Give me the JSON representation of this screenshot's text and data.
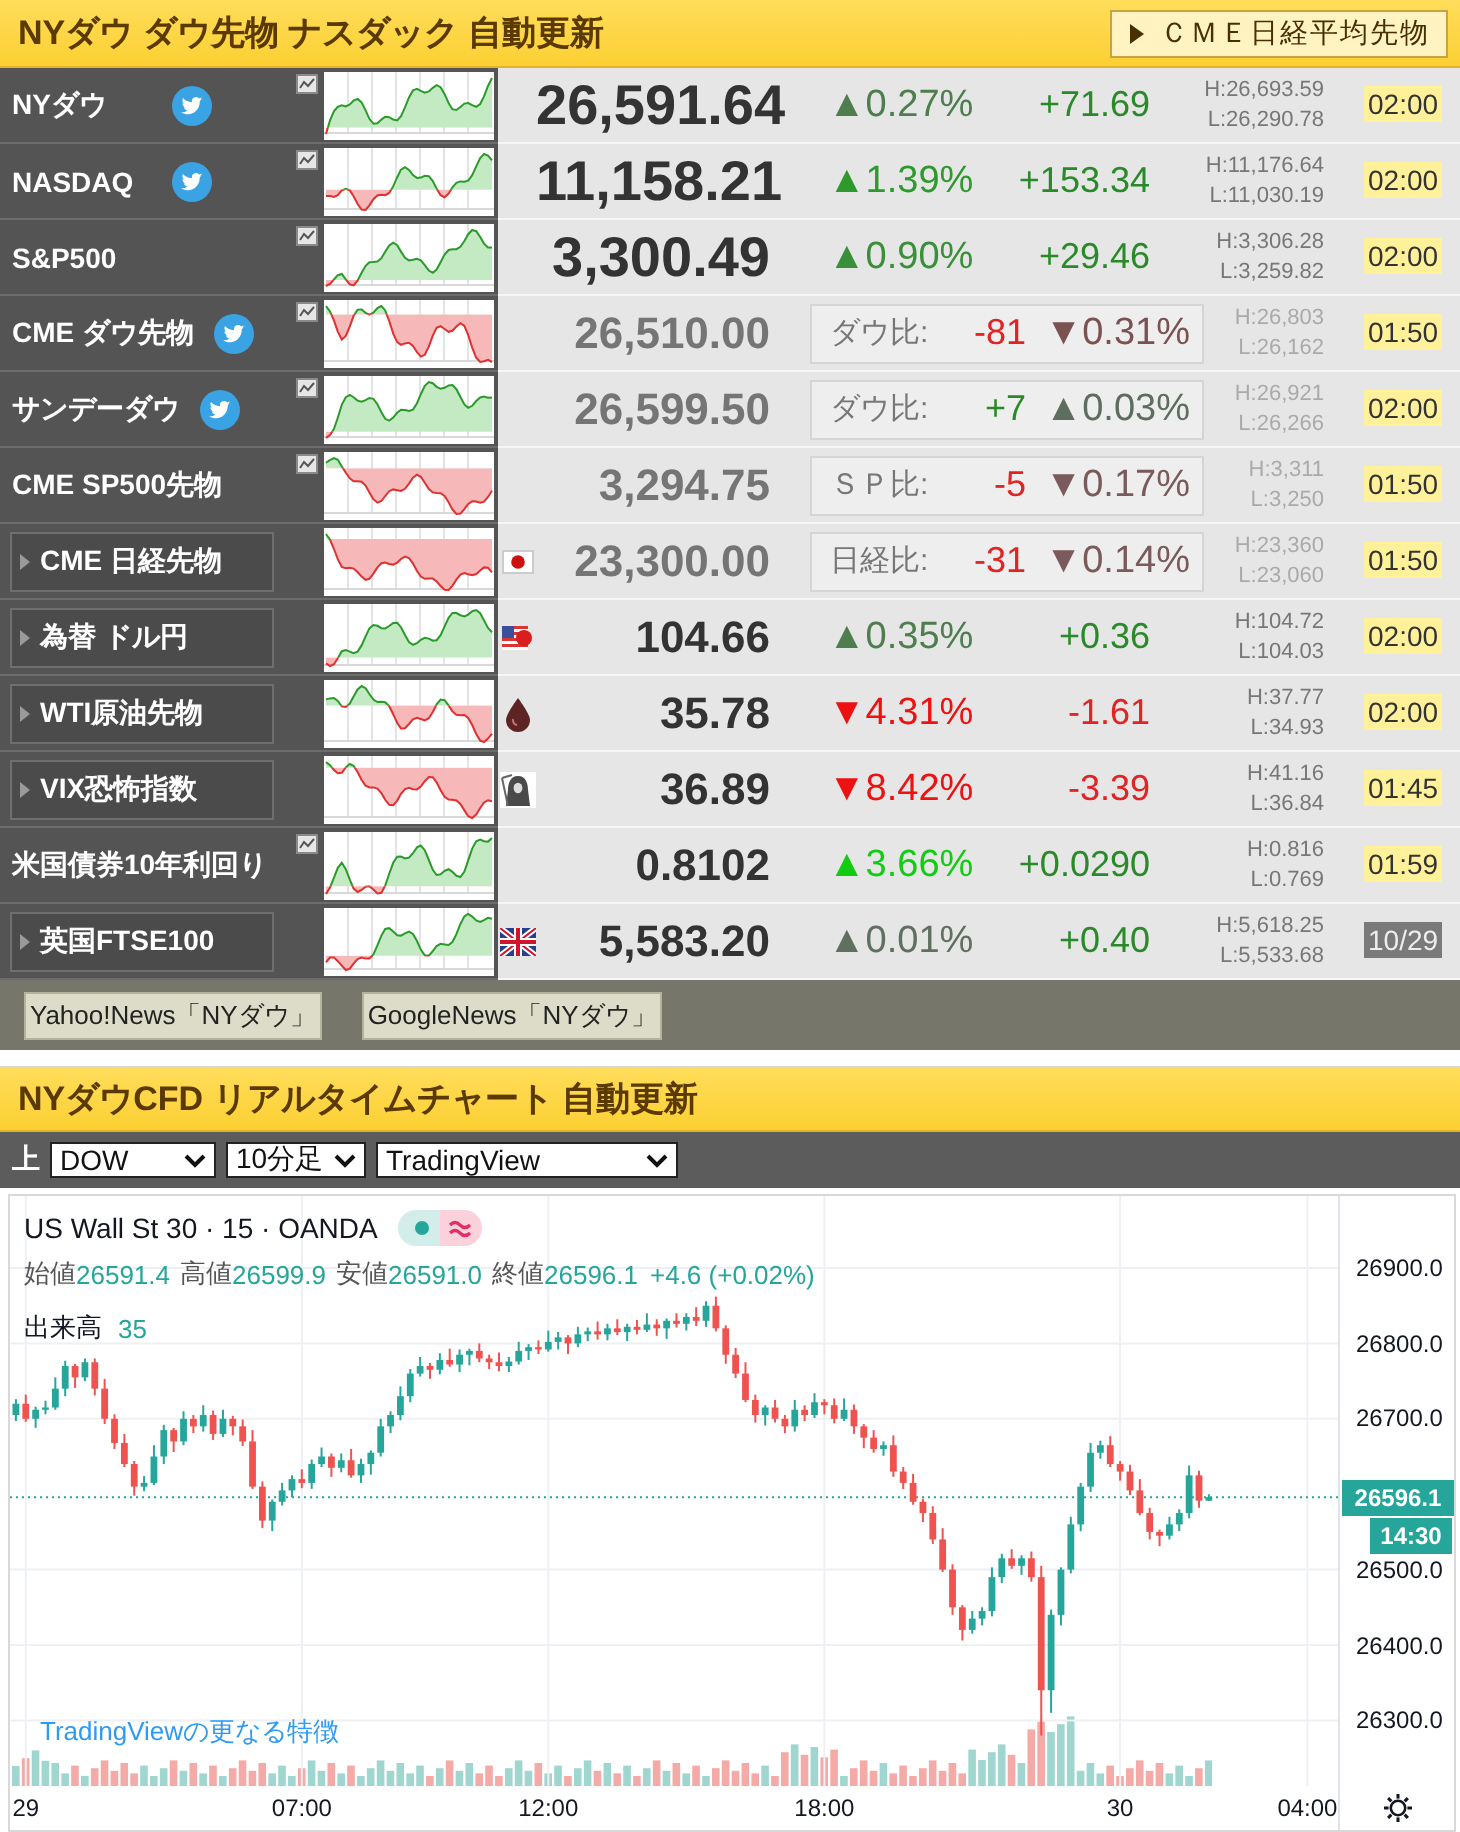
{
  "header": {
    "title": "NYダウ ダウ先物 ナスダック 自動更新",
    "link": "ＣＭＥ日経平均先物"
  },
  "quotes": [
    {
      "kind": "major",
      "name": "NYダウ",
      "twitter": true,
      "chart_button": true,
      "expandable": false,
      "rising": true,
      "price": "26,591.64",
      "percent": {
        "text": "▲0.27%",
        "color": "#4e7d4e"
      },
      "change": "+71.69",
      "high": "H:26,693.59",
      "low": "L:26,290.78",
      "time": "02:00",
      "closed": false
    },
    {
      "kind": "major",
      "name": "NASDAQ",
      "twitter": true,
      "chart_button": true,
      "expandable": false,
      "rising": true,
      "price": "11,158.21",
      "percent": {
        "text": "▲1.39%",
        "color": "#2e9a2e"
      },
      "change": "+153.34",
      "high": "H:11,176.64",
      "low": "L:11,030.19",
      "time": "02:00",
      "closed": false
    },
    {
      "kind": "major",
      "name": "S&P500",
      "twitter": false,
      "chart_button": true,
      "expandable": false,
      "rising": true,
      "price": "3,300.49",
      "percent": {
        "text": "▲0.90%",
        "color": "#3a8f3a"
      },
      "change": "+29.46",
      "high": "H:3,306.28",
      "low": "L:3,259.82",
      "time": "02:00",
      "closed": false
    },
    {
      "kind": "future",
      "name": "CME ダウ先物",
      "twitter": true,
      "chart_button": true,
      "expandable": false,
      "rising": false,
      "price": "26,510.00",
      "compare": {
        "label": "ダウ比:",
        "diff": "-81",
        "percent": "▼0.31%",
        "color": "#7a5252"
      },
      "high": "H:26,803",
      "low": "L:26,162",
      "time": "01:50",
      "closed": false
    },
    {
      "kind": "future",
      "name": "サンデーダウ",
      "twitter": true,
      "chart_button": true,
      "expandable": false,
      "rising": true,
      "price": "26,599.50",
      "compare": {
        "label": "ダウ比:",
        "diff": "+7",
        "percent": "▲0.03%",
        "color": "#5e6e5e"
      },
      "high": "H:26,921",
      "low": "L:26,266",
      "time": "02:00",
      "closed": false
    },
    {
      "kind": "future",
      "name": "CME SP500先物",
      "twitter": false,
      "chart_button": true,
      "expandable": false,
      "rising": false,
      "price": "3,294.75",
      "compare": {
        "label": "ＳＰ比:",
        "diff": "-5",
        "percent": "▼0.17%",
        "color": "#7a5a5a"
      },
      "high": "H:3,311",
      "low": "L:3,250",
      "time": "01:50",
      "closed": false
    },
    {
      "kind": "future",
      "name": "CME 日経先物",
      "twitter": false,
      "chart_button": false,
      "expandable": true,
      "rising": false,
      "price": "23,300.00",
      "compare": {
        "label": "日経比:",
        "diff": "-31",
        "percent": "▼0.14%",
        "color": "#7a5a5a"
      },
      "high": "H:23,360",
      "low": "L:23,060",
      "time": "01:50",
      "closed": false
    },
    {
      "kind": "other",
      "name": "為替 ドル円",
      "twitter": false,
      "chart_button": false,
      "expandable": true,
      "rising": true,
      "price": "104.66",
      "percent": {
        "text": "▲0.35%",
        "color": "#4e7d4e"
      },
      "change": "+0.36",
      "high": "H:104.72",
      "low": "L:104.03",
      "time": "02:00",
      "closed": false
    },
    {
      "kind": "other",
      "name": "WTI原油先物",
      "twitter": false,
      "chart_button": false,
      "expandable": true,
      "rising": false,
      "price": "35.78",
      "percent": {
        "text": "▼4.31%",
        "color": "#ee1111"
      },
      "change": "-1.61",
      "high": "H:37.77",
      "low": "L:34.93",
      "time": "02:00",
      "closed": false
    },
    {
      "kind": "other",
      "name": "VIX恐怖指数",
      "twitter": false,
      "chart_button": false,
      "expandable": true,
      "rising": false,
      "price": "36.89",
      "percent": {
        "text": "▼8.42%",
        "color": "#ee1111"
      },
      "change": "-3.39",
      "high": "H:41.16",
      "low": "L:36.84",
      "time": "01:45",
      "closed": false
    },
    {
      "kind": "other",
      "name": "米国債券10年利回り",
      "twitter": false,
      "chart_button": true,
      "expandable": false,
      "rising": true,
      "price": "0.8102",
      "percent": {
        "text": "▲3.66%",
        "color": "#11cc11"
      },
      "change": "+0.0290",
      "high": "H:0.816",
      "low": "L:0.769",
      "time": "01:59",
      "closed": false
    },
    {
      "kind": "other",
      "name": "英国FTSE100",
      "twitter": false,
      "chart_button": false,
      "expandable": true,
      "rising": true,
      "price": "5,583.20",
      "percent": {
        "text": "▲0.01%",
        "color": "#607060"
      },
      "change": "+0.40",
      "high": "H:5,618.25",
      "low": "L:5,533.68",
      "time": "10/29",
      "closed": true
    }
  ],
  "news_links": [
    "Yahoo!News「NYダウ」",
    "GoogleNews「NYダウ」"
  ],
  "chart_section": {
    "title": "NYダウCFD リアルタイムチャート 自動更新",
    "toolbar": {
      "label": "上",
      "selects": [
        "DOW",
        "10分足",
        "TradingView"
      ]
    },
    "chart": {
      "symbol": "US Wall St 30 · 15 · OANDA",
      "ohlc": [
        {
          "label": "始値",
          "value": "26591.4"
        },
        {
          "label": "高値",
          "value": "26599.9"
        },
        {
          "label": "安値",
          "value": "26591.0"
        },
        {
          "label": "終値",
          "value": "26596.1"
        }
      ],
      "change": "+4.6 (+0.02%)",
      "volume_label": "出来高",
      "volume": "35",
      "last_price": "26596.1",
      "countdown": "14:30",
      "promo_link": "TradingViewの更なる特徴",
      "chart_data": {
        "type": "candlestick",
        "categories": [
          null,
          "29",
          null,
          null,
          null,
          null,
          null,
          null,
          null,
          null,
          null,
          null,
          null,
          null,
          null,
          null,
          null,
          null,
          null,
          null,
          null,
          null,
          null,
          null,
          null,
          null,
          null,
          null,
          null,
          "07:00",
          null,
          null,
          null,
          null,
          null,
          null,
          null,
          null,
          null,
          null,
          null,
          null,
          null,
          null,
          null,
          null,
          null,
          null,
          null,
          null,
          null,
          null,
          null,
          null,
          "12:00",
          null,
          null,
          null,
          null,
          null,
          null,
          null,
          null,
          null,
          null,
          null,
          null,
          null,
          null,
          null,
          null,
          null,
          null,
          null,
          null,
          null,
          null,
          null,
          null,
          null,
          null,
          null,
          "18:00",
          null,
          null,
          null,
          null,
          null,
          null,
          null,
          null,
          null,
          null,
          null,
          null,
          null,
          null,
          null,
          null,
          null,
          null,
          null,
          null,
          null,
          null,
          null,
          null,
          null,
          null,
          null,
          null,
          null,
          "30",
          null,
          null,
          null,
          null,
          null,
          null,
          null,
          null,
          null,
          null,
          null,
          null,
          null,
          null,
          null,
          null,
          null,
          null,
          "04:00"
        ],
        "ohlc": [
          [
            26705,
            26726,
            26697,
            26720
          ],
          [
            26720,
            26732,
            26696,
            26700
          ],
          [
            26700,
            26716,
            26688,
            26712
          ],
          [
            26712,
            26724,
            26706,
            26715
          ],
          [
            26715,
            26755,
            26712,
            26740
          ],
          [
            26740,
            26777,
            26730,
            26770
          ],
          [
            26770,
            26773,
            26741,
            26755
          ],
          [
            26755,
            26780,
            26750,
            26775
          ],
          [
            26775,
            26780,
            26731,
            26740
          ],
          [
            26740,
            26753,
            26693,
            26700
          ],
          [
            26700,
            26706,
            26660,
            26668
          ],
          [
            26668,
            26680,
            26636,
            26640
          ],
          [
            26640,
            26644,
            26598,
            26610
          ],
          [
            26610,
            26624,
            26604,
            26615
          ],
          [
            26615,
            26665,
            26612,
            26650
          ],
          [
            26650,
            26692,
            26640,
            26685
          ],
          [
            26685,
            26688,
            26656,
            26670
          ],
          [
            26670,
            26710,
            26665,
            26700
          ],
          [
            26700,
            26705,
            26681,
            26690
          ],
          [
            26690,
            26718,
            26683,
            26705
          ],
          [
            26705,
            26711,
            26672,
            26680
          ],
          [
            26680,
            26712,
            26676,
            26700
          ],
          [
            26700,
            26704,
            26678,
            26690
          ],
          [
            26690,
            26699,
            26664,
            26670
          ],
          [
            26670,
            26685,
            26607,
            26610
          ],
          [
            26610,
            26617,
            26555,
            26565
          ],
          [
            26565,
            26593,
            26551,
            26590
          ],
          [
            26590,
            26615,
            26585,
            26605
          ],
          [
            26605,
            26625,
            26596,
            26620
          ],
          [
            26620,
            26633,
            26608,
            26615
          ],
          [
            26615,
            26646,
            26607,
            26640
          ],
          [
            26640,
            26662,
            26636,
            26650
          ],
          [
            26650,
            26654,
            26623,
            26635
          ],
          [
            26635,
            26654,
            26629,
            26645
          ],
          [
            26645,
            26660,
            26622,
            26625
          ],
          [
            26625,
            26647,
            26615,
            26640
          ],
          [
            26640,
            26658,
            26626,
            26655
          ],
          [
            26655,
            26700,
            26650,
            26690
          ],
          [
            26690,
            26710,
            26681,
            26705
          ],
          [
            26705,
            26743,
            26698,
            26730
          ],
          [
            26730,
            26766,
            26722,
            26760
          ],
          [
            26760,
            26782,
            26756,
            26770
          ],
          [
            26770,
            26774,
            26753,
            26765
          ],
          [
            26765,
            26787,
            26759,
            26778
          ],
          [
            26778,
            26793,
            26769,
            26772
          ],
          [
            26772,
            26792,
            26762,
            26785
          ],
          [
            26785,
            26793,
            26771,
            26790
          ],
          [
            26790,
            26800,
            26775,
            26780
          ],
          [
            26780,
            26785,
            26766,
            26775
          ],
          [
            26775,
            26788,
            26763,
            26770
          ],
          [
            26770,
            26782,
            26762,
            26776
          ],
          [
            26776,
            26802,
            26772,
            26790
          ],
          [
            26790,
            26799,
            26778,
            26795
          ],
          [
            26795,
            26804,
            26786,
            26792
          ],
          [
            26792,
            26817,
            26789,
            26802
          ],
          [
            26802,
            26815,
            26792,
            26808
          ],
          [
            26808,
            26811,
            26786,
            26800
          ],
          [
            26800,
            26822,
            26795,
            26812
          ],
          [
            26812,
            26821,
            26803,
            26816
          ],
          [
            26816,
            26829,
            26805,
            26812
          ],
          [
            26812,
            26826,
            26804,
            26820
          ],
          [
            26820,
            26832,
            26811,
            26815
          ],
          [
            26815,
            26826,
            26803,
            26822
          ],
          [
            26822,
            26831,
            26812,
            26818
          ],
          [
            26818,
            26840,
            26815,
            26825
          ],
          [
            26825,
            26832,
            26810,
            26820
          ],
          [
            26820,
            26833,
            26806,
            26830
          ],
          [
            26830,
            26840,
            26821,
            26826
          ],
          [
            26826,
            26840,
            26817,
            26835
          ],
          [
            26835,
            26848,
            26823,
            26830
          ],
          [
            26830,
            26856,
            26822,
            26850
          ],
          [
            26850,
            26862,
            26816,
            26820
          ],
          [
            26820,
            26824,
            26773,
            26785
          ],
          [
            26785,
            26794,
            26754,
            26760
          ],
          [
            26760,
            26775,
            26722,
            26725
          ],
          [
            26725,
            26732,
            26695,
            26705
          ],
          [
            26705,
            26718,
            26691,
            26715
          ],
          [
            26715,
            26725,
            26695,
            26700
          ],
          [
            26700,
            26705,
            26681,
            26690
          ],
          [
            26690,
            26725,
            26683,
            26712
          ],
          [
            26712,
            26718,
            26697,
            26705
          ],
          [
            26705,
            26734,
            26701,
            26722
          ],
          [
            26722,
            26726,
            26706,
            26718
          ],
          [
            26718,
            26727,
            26694,
            26700
          ],
          [
            26700,
            26727,
            26697,
            26712
          ],
          [
            26712,
            26719,
            26680,
            26690
          ],
          [
            26690,
            26693,
            26661,
            26675
          ],
          [
            26675,
            26685,
            26655,
            26660
          ],
          [
            26660,
            26670,
            26651,
            26665
          ],
          [
            26665,
            26678,
            26623,
            26630
          ],
          [
            26630,
            26636,
            26607,
            26615
          ],
          [
            26615,
            26627,
            26586,
            26590
          ],
          [
            26590,
            26594,
            26563,
            26575
          ],
          [
            26575,
            26584,
            26534,
            26540
          ],
          [
            26540,
            26555,
            26497,
            26500
          ],
          [
            26500,
            26507,
            26440,
            26450
          ],
          [
            26450,
            26453,
            26406,
            26420
          ],
          [
            26420,
            26445,
            26415,
            26435
          ],
          [
            26435,
            26450,
            26426,
            26445
          ],
          [
            26445,
            26503,
            26438,
            26490
          ],
          [
            26490,
            26521,
            26482,
            26515
          ],
          [
            26515,
            26527,
            26501,
            26505
          ],
          [
            26505,
            26519,
            26493,
            26515
          ],
          [
            26515,
            26524,
            26484,
            26490
          ],
          [
            26490,
            26505,
            26280,
            26340
          ],
          [
            26340,
            26447,
            26310,
            26440
          ],
          [
            26440,
            26503,
            26426,
            26500
          ],
          [
            26500,
            26570,
            26495,
            26560
          ],
          [
            26560,
            26615,
            26551,
            26610
          ],
          [
            26610,
            26668,
            26603,
            26655
          ],
          [
            26655,
            26671,
            26647,
            26665
          ],
          [
            26665,
            26677,
            26636,
            26640
          ],
          [
            26640,
            26644,
            26618,
            26630
          ],
          [
            26630,
            26639,
            26599,
            26605
          ],
          [
            26605,
            26620,
            26572,
            26575
          ],
          [
            26575,
            26582,
            26540,
            26550
          ],
          [
            26550,
            26553,
            26531,
            26545
          ],
          [
            26545,
            26570,
            26540,
            26560
          ],
          [
            26560,
            26580,
            26551,
            26575
          ],
          [
            26575,
            26638,
            26568,
            26625
          ],
          [
            26625,
            26631,
            26582,
            26591.4
          ],
          [
            26591.4,
            26599.9,
            26591.0,
            26596.1
          ],
          null,
          null,
          null,
          null,
          null,
          null,
          null,
          null,
          null,
          null
        ],
        "ylim": [
          26213,
          26995.5
        ],
        "grid": true,
        "ref_lines": [
          {
            "axis": "y",
            "value": 26596.1,
            "color": "#26a69a"
          }
        ],
        "yticks": [
          {
            "value": 26900,
            "label": "26900.0"
          },
          {
            "value": 26800,
            "label": "26800.0"
          },
          {
            "value": 26700,
            "label": "26700.0"
          },
          {
            "value": 26500,
            "label": "26500.0"
          },
          {
            "value": 26400,
            "label": "26400.0"
          },
          {
            "value": 26300,
            "label": "26300.0"
          }
        ]
      }
    }
  }
}
